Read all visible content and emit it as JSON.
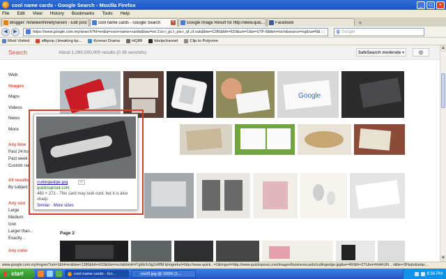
{
  "window": {
    "title": "cool name cards - Google Search - Mozilla Firefox",
    "controls": [
      "_",
      "□",
      "×"
    ]
  },
  "menu": [
    "File",
    "Edit",
    "View",
    "History",
    "Bookmarks",
    "Tools",
    "Help"
  ],
  "tabs": [
    {
      "label": "Blogger: NineteenNinetySeven - Edit post",
      "icon_color": "#f57d00",
      "active": false
    },
    {
      "label": "cool name cards - Google Search",
      "icon_color": "#4a7bd8",
      "active": true
    },
    {
      "label": "Google Image Result for http://www.quic...",
      "icon_color": "#4a7bd8",
      "active": false
    },
    {
      "label": "Facebook",
      "icon_color": "#3b5998",
      "active": false
    }
  ],
  "nav": {
    "url": "https://www.google.com.my/search?hl=en&q=cool+name+cards&bav=on.2,or.r_gc.r_pw.r_qf.,cf.osb&biw=1280&bih=633&um=1&ie=UTF-8&tbm=isch&source=og&sa=N&tab=wi",
    "search_placeholder": "Google"
  },
  "bookmarks": [
    {
      "label": "Most Visited",
      "icon_color": "#5a7fc0"
    },
    {
      "label": "allkpop | breaking kp...",
      "icon_color": "#d6452e"
    },
    {
      "label": "Korean Drama",
      "icon_color": "#3a8ac8"
    },
    {
      "label": "HQ88",
      "icon_color": "#6a6a6a"
    },
    {
      "label": "bbvipchannel",
      "icon_color": "#2b2b2b"
    },
    {
      "label": "Clip to Polyvore",
      "icon_color": "#8a8a8a"
    }
  ],
  "google": {
    "search_label": "Search",
    "result_stats": "About 1,080,000,000 results (0.36 seconds)",
    "safesearch": "SafeSearch moderate ▾",
    "settings_icon": "⚙"
  },
  "left_nav": [
    "Web",
    "Images",
    "Maps",
    "Videos",
    "News",
    "More"
  ],
  "filters": {
    "time": {
      "head": "Any time",
      "options": [
        "Past 24 ho",
        "Past week",
        "Custom ran"
      ]
    },
    "results": {
      "head": "All results",
      "options": [
        "By subject"
      ]
    },
    "size": {
      "head": "Any size",
      "options": [
        "Large",
        "Medium",
        "Icon",
        "Larger than...",
        "Exactly..."
      ]
    },
    "color": {
      "head": "Any color"
    }
  },
  "page2_label": "Page 2",
  "hover_card": {
    "filename": "cuttingedge.jpg",
    "chip": "✓",
    "domain": "quickssprout.com",
    "description": "460 × 271 - This card may look cool, but it is also sharp.",
    "similar": "Similar",
    "more_sizes": "More sizes"
  },
  "status_url": "www.google.com.my/imgres?um=1&hl=en&biw=1280&bih=633&tbm=isch&tbnid=tTgMz3c9g2zRfM:&imgrefurl=http://www.quick...=1&imgurl=http://www.quicksprout.com/images/businesscards/cuttingedge.jpg&w=460&h=271&ei=hhAhUN... r&lbn=3Fkqtx&amp;...",
  "scrollbar": {
    "up": "▲",
    "down": "▼"
  },
  "taskbar": {
    "start": "start",
    "tasks": [
      {
        "label": "cool name cards - Go...",
        "active": true
      },
      {
        "label": "roof3 jpg @ 100% (1...",
        "active": false
      }
    ],
    "clock": "8:56 PM"
  }
}
